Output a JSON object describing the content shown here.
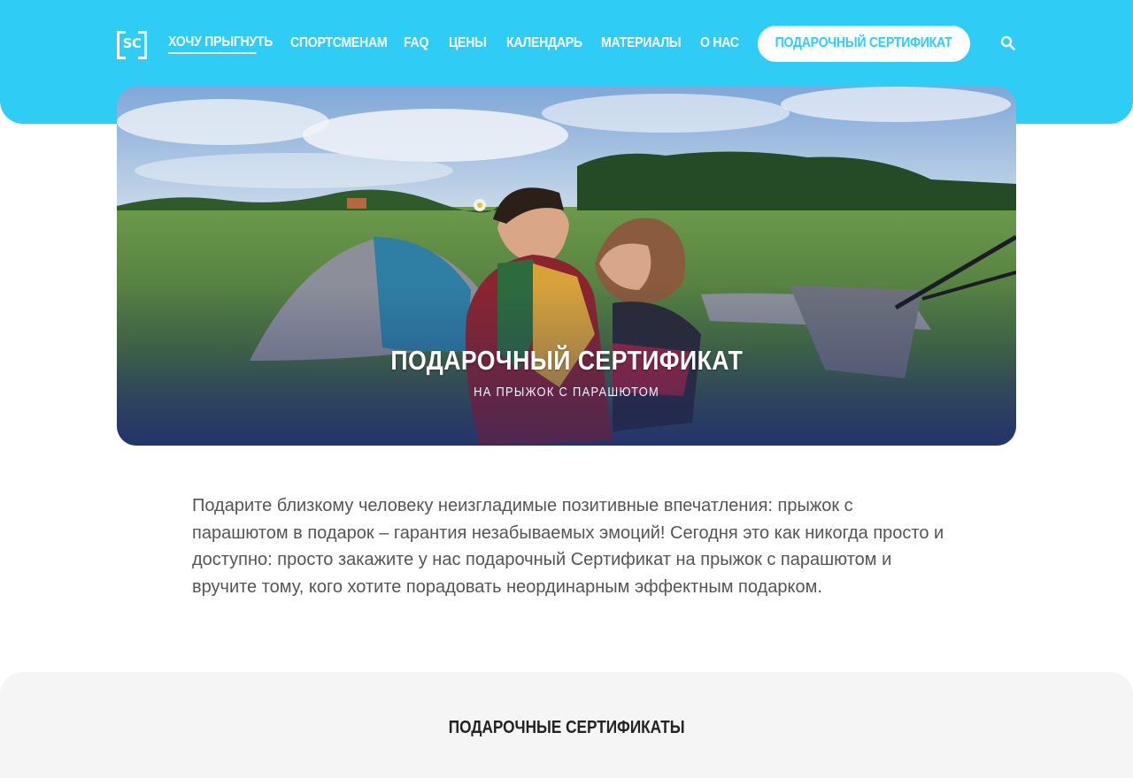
{
  "header": {
    "logo_text": "SC",
    "nav": [
      {
        "label": "Хочу прыгнуть",
        "active": true
      },
      {
        "label": "Спортсменам"
      },
      {
        "label": "FAQ"
      },
      {
        "label": "Цены"
      },
      {
        "label": "Календарь"
      },
      {
        "label": "Материалы"
      },
      {
        "label": "О нас"
      }
    ],
    "cta_label": "Подарочный сертификат",
    "search_icon": "search-icon",
    "accent_color": "#2fcdf6"
  },
  "hero": {
    "title": "Подарочный сертификат",
    "subtitle": "на прыжок с парашютом"
  },
  "intro": {
    "text": "Подарите близкому человеку неизгладимые позитивные впечатления: прыжок с парашютом в подарок – гарантия незабываемых эмоций! Сегодня это как никогда просто и доступно: просто закажите у нас подарочный Сертификат на прыжок с парашютом и вручите тому, кого хотите порадовать неординарным эффектным подарком."
  },
  "section2": {
    "title": "Подарочные сертификаты"
  }
}
